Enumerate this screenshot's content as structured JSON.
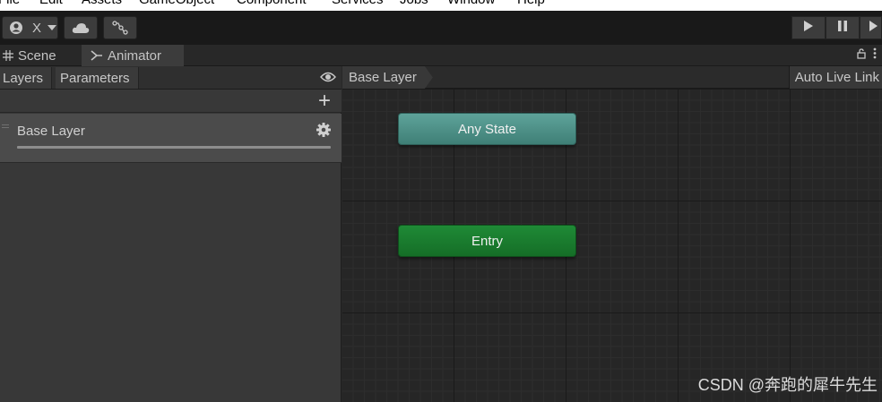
{
  "menu": {
    "items": [
      "File",
      "Edit",
      "Assets",
      "GameObject",
      "Component",
      "Services",
      "Jobs",
      "Window",
      "Help"
    ]
  },
  "toolbar": {
    "account_label": "X",
    "account_icon": "account-icon",
    "cloud_icon": "cloud-icon",
    "collab_icon": "collab-icon",
    "play_icon": "play-icon",
    "pause_icon": "pause-icon",
    "step_icon": "step-icon"
  },
  "tabs": [
    {
      "label": "Scene",
      "icon": "scene-grid-icon",
      "active": false
    },
    {
      "label": "Animator",
      "icon": "animator-icon",
      "active": true
    }
  ],
  "left_panel": {
    "tabs": [
      "Layers",
      "Parameters"
    ],
    "add_label": "+",
    "layers": [
      {
        "name": "Base Layer",
        "weight": 1.0
      }
    ]
  },
  "graph": {
    "breadcrumb": "Base Layer",
    "auto_live_link": "Auto Live Link",
    "nodes": [
      {
        "label": "Any State",
        "kind": "any-state",
        "color": "#4f9189"
      },
      {
        "label": "Entry",
        "kind": "entry",
        "color": "#1a7c2e"
      }
    ]
  },
  "watermark": "CSDN @奔跑的犀牛先生"
}
